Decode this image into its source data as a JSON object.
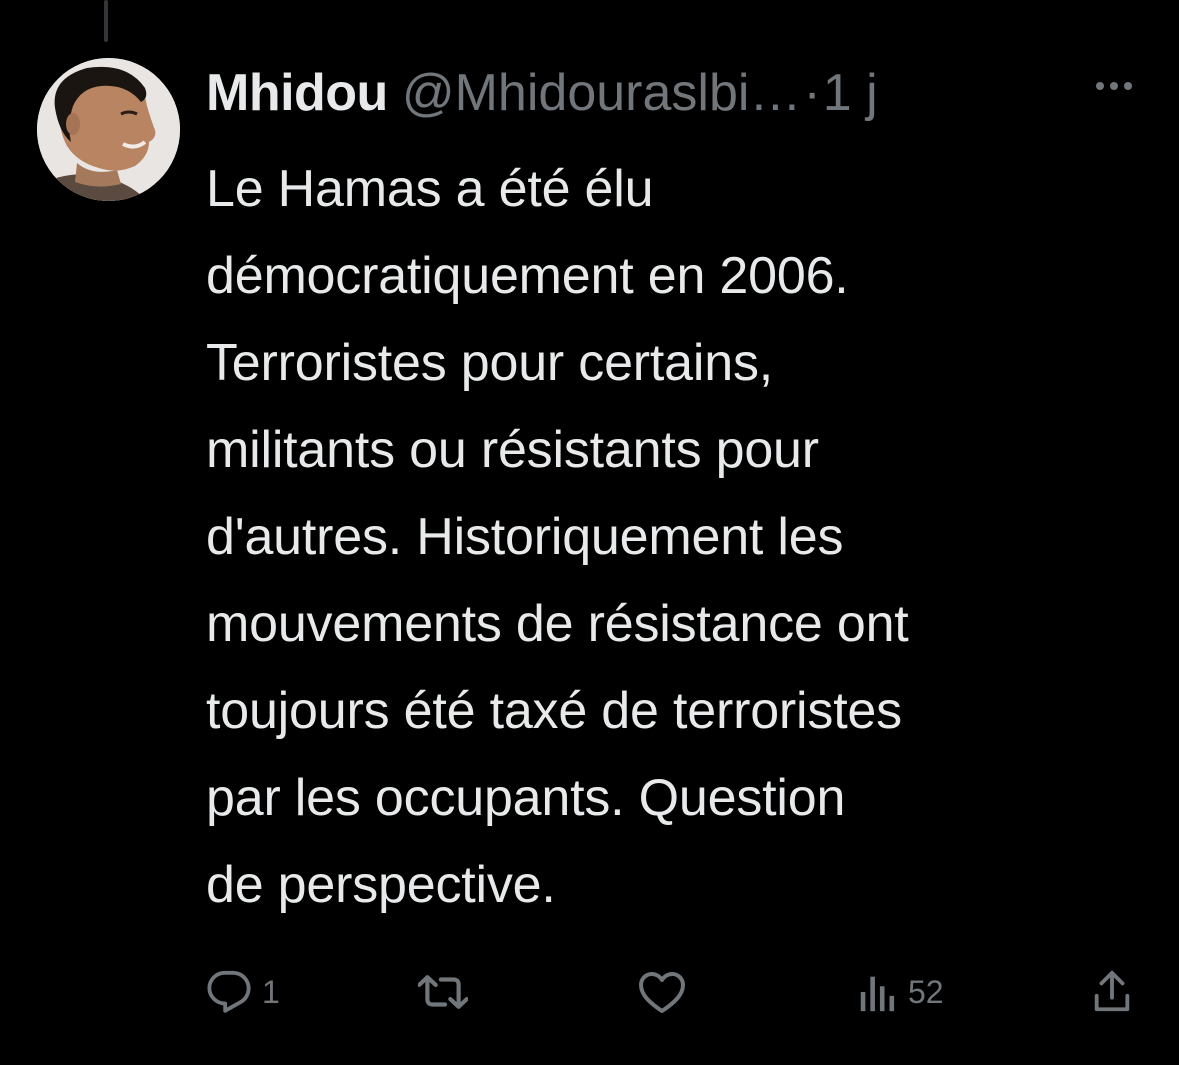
{
  "tweet": {
    "author_name": "Mhidou",
    "handle": "@Mhidouraslbi…",
    "separator": "·",
    "time": "1 j",
    "text_lines": [
      "Le Hamas a été élu",
      "démocratiquement en 2006.",
      "Terroristes pour certains,",
      "militants ou résistants pour",
      "d'autres. Historiquement les",
      "mouvements de résistance ont",
      "toujours été taxé de terroristes",
      "par les occupants. Question",
      "de perspective."
    ]
  },
  "actions": {
    "reply_icon": "reply-icon",
    "reply_count": "1",
    "retweet_icon": "retweet-icon",
    "like_icon": "heart-icon",
    "views_icon": "views-chart-icon",
    "views_count": "52",
    "share_icon": "share-icon"
  },
  "colors": {
    "background": "#000000",
    "text_primary": "#e7e9ea",
    "text_secondary": "#71767b",
    "thread_line": "#333639"
  }
}
